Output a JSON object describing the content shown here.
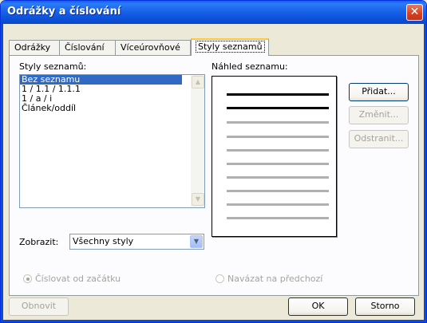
{
  "window": {
    "title": "Odrážky a číslování",
    "close_glyph": "✕"
  },
  "tabs": [
    {
      "label": "Odrážky",
      "active": false
    },
    {
      "label": "Číslování",
      "active": false
    },
    {
      "label": "Víceúrovňové",
      "active": false
    },
    {
      "label": "Styly seznamů",
      "active": true
    }
  ],
  "styles_label": "Styly seznamů:",
  "preview_label": "Náhled seznamu:",
  "list_items": [
    "Bez seznamu",
    "1 / 1.1 / 1.1.1",
    "1 / a / i",
    "Článek/oddíl"
  ],
  "selected_index": 0,
  "scroll_icons": {
    "up": "up-arrow-icon",
    "down": "down-arrow-icon"
  },
  "buttons": {
    "add": "Přidat...",
    "modify": "Změnit...",
    "delete": "Odstranit...",
    "reset": "Obnovit",
    "ok": "OK",
    "cancel": "Storno"
  },
  "show_label": "Zobrazit:",
  "show_value": "Všechny styly",
  "radio_restart": "Číslovat od začátku",
  "radio_continue": "Navázat na předchozí",
  "colors": {
    "selection": "#316ac5",
    "preview_dark": "#000000",
    "preview_light": "#b0b0b0",
    "titlebar": "#0a5ff5"
  }
}
